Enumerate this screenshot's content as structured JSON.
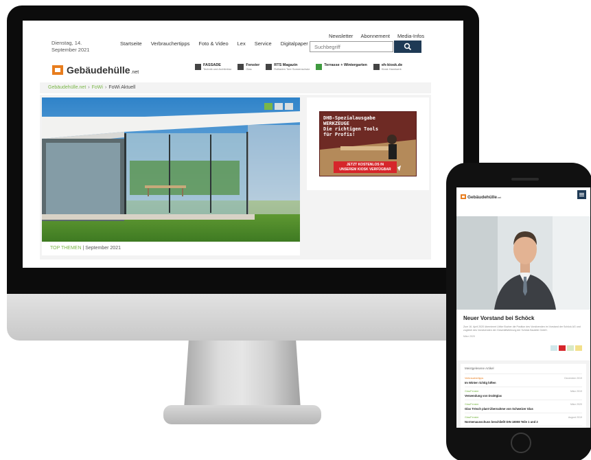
{
  "desktop": {
    "date_line1": "Dienstag, 14.",
    "date_line2": "September 2021",
    "main_nav": [
      "Startseite",
      "Verbrauchertipps",
      "Foto & Video",
      "Lex",
      "Service",
      "Digitalpaper"
    ],
    "util_nav": [
      "Newsletter",
      "Abonnement",
      "Media-Infos"
    ],
    "search_placeholder": "Suchbegriff",
    "logo_text": "Gebäudehülle",
    "logo_suffix": ".net",
    "publications": [
      {
        "name": "FASSADE",
        "sub": "Technik und Architektur"
      },
      {
        "name": "Fenster",
        "sub": "Glas"
      },
      {
        "name": "RTS Magazin",
        "sub": "Rollladen Tore Sonnenschutz"
      },
      {
        "name": "Terrasse + Wintergarten",
        "sub": ""
      },
      {
        "name": "eh-kiosk.de",
        "sub": "Kiosk Handwerk"
      }
    ],
    "breadcrumb": [
      "Gebäudehülle.net",
      "FoWi",
      "FoWi Aktuell"
    ],
    "caption_category": "TOP THEMEN",
    "caption_rest": " | September 2021",
    "ad": {
      "line1": "DHB-Spezialausgabe",
      "line2": "WERKZEUGE",
      "line3": "Die richtigen Tools",
      "line4": "für Profis!",
      "cta1": "JETZT KOSTENLOS IN",
      "cta2": "UNSEREM KIOSK VERFÜGBAR"
    }
  },
  "mobile": {
    "logo_text": "Gebäudehülle",
    "logo_suffix": ".net",
    "headline": "Neuer Vorstand bei Schöck",
    "teaser": "Zum 16. April 2020 übernimmt Ulrike Bucher die Position des Vorsitzenden im Vorstand der Schöck AG und zugleich des Vorsitzenden der Geschäftsführung der Schöck Bauteile GmbH.",
    "date": "März 2020",
    "list_title": "Meistgelesene Artikel",
    "articles": [
      {
        "category": "Verbrauchertipps",
        "date": "Dezember 2019",
        "title": "Im Winter richtig lüften"
      },
      {
        "category": "Glas/Fenster",
        "date": "März 2019",
        "title": "Verwendung von Drahtglas"
      },
      {
        "category": "Glas/Fenster",
        "date": "März 2020",
        "title": "Glas Trösch plant Übernahme von Schweizer Glas"
      },
      {
        "category": "Glas/Fenster",
        "date": "August 2019",
        "title": "Normenausschuss beschließt DIN 18008 Teile 1 und 2"
      }
    ]
  },
  "colors": {
    "accent_green": "#7ab648",
    "brand_orange": "#e87d1e",
    "navy": "#1f3a55",
    "ad_red": "#d6262b"
  }
}
